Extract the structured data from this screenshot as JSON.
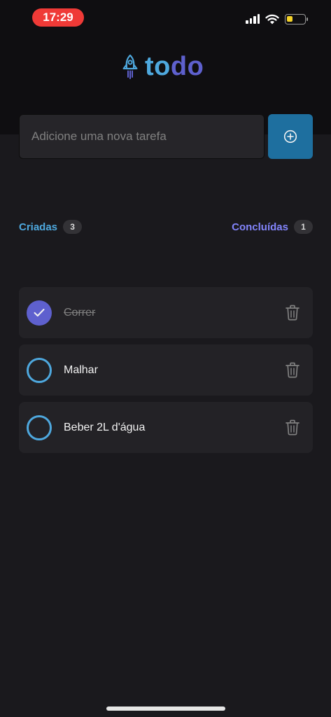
{
  "status_bar": {
    "time": "17:29",
    "icons": [
      "cellular-signal-icon",
      "wifi-icon",
      "battery-icon"
    ],
    "battery_level": 0.35,
    "battery_color": "#f5d329",
    "time_pill_color": "#ef3a37"
  },
  "logo": {
    "icon": "rocket-icon",
    "text_part1": "to",
    "text_part2": "do",
    "colors": {
      "part1": "#4ea8de",
      "part2": "#5e60ce"
    }
  },
  "new_task": {
    "placeholder": "Adicione uma nova tarefa",
    "value": "",
    "add_icon": "plus-circle-icon",
    "button_color": "#1e6f9f"
  },
  "counters": {
    "created_label": "Criadas",
    "created_count": "3",
    "done_label": "Concluídas",
    "done_count": "1"
  },
  "tasks": [
    {
      "text": "Correr",
      "done": true
    },
    {
      "text": "Malhar",
      "done": false
    },
    {
      "text": "Beber 2L d'água",
      "done": false
    }
  ],
  "task_icons": {
    "checked": "check-icon",
    "unchecked": "circle-icon",
    "delete": "trash-icon"
  }
}
